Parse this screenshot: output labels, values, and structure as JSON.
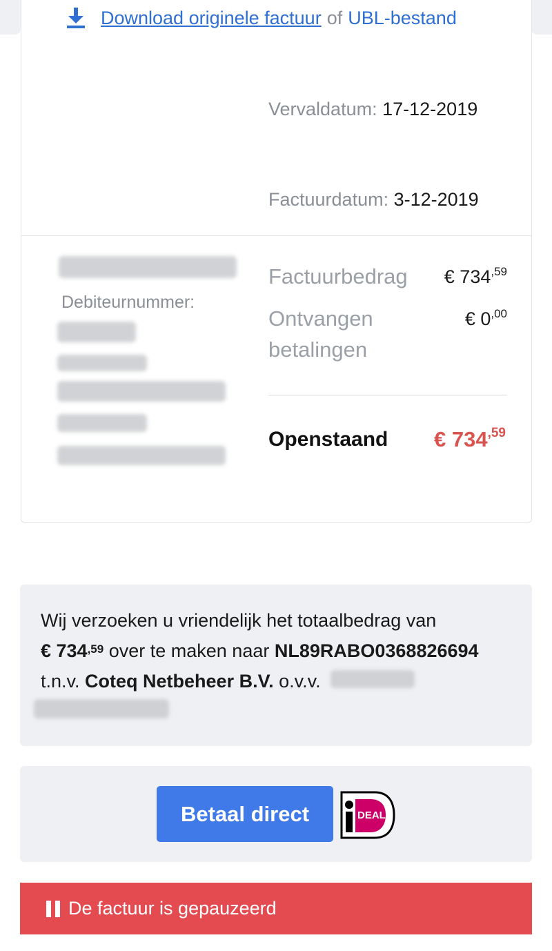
{
  "download": {
    "link_original": "Download originele factuur",
    "or_word": "of",
    "link_ubl": "UBL-bestand"
  },
  "invoice": {
    "due_label": "Vervaldatum:",
    "due_value": "17-12-2019",
    "date_label": "Factuurdatum:",
    "date_value": "3-12-2019",
    "debtor_label": "Debiteurnummer:"
  },
  "amounts": {
    "invoice_label": "Factuurbedrag",
    "invoice_value_main": "€ 734",
    "invoice_value_cents": ",59",
    "received_label_1": "Ontvangen",
    "received_label_2": "betalingen",
    "received_value_main": "€ 0",
    "received_value_cents": ",00",
    "open_label": "Openstaand",
    "open_value_main": "€ 734",
    "open_value_cents": ",59"
  },
  "payment_request": {
    "line1": "Wij verzoeken u vriendelijk het totaalbedrag van",
    "amount_main": "€ 734",
    "amount_cents": ",59",
    "transfer_text": " over te maken naar ",
    "iban": "NL89RABO0368826694",
    "tnv_label": "t.n.v. ",
    "company": "Coteq Netbeheer B.V.",
    "ovv_label": " o.v.v. "
  },
  "pay_button": {
    "label": "Betaal direct",
    "ideal_text": "DEAL"
  },
  "status": {
    "text": "De factuur is gepauzeerd"
  },
  "colors": {
    "link": "#2f6fd1",
    "button": "#3f7ae8",
    "open_amount": "#d9534f",
    "banner": "#e34b51",
    "ideal": "#cc0066"
  }
}
